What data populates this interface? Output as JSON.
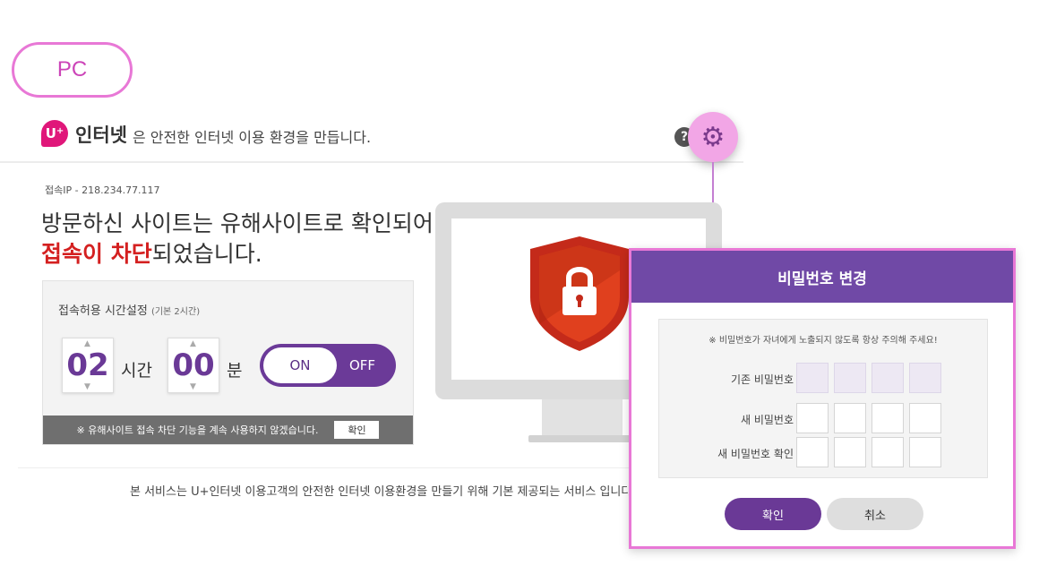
{
  "pc_tag": "PC",
  "header": {
    "logo_text": "U",
    "brand_name": "인터넷",
    "tagline": "은 안전한 인터넷 이용 환경을 만듭니다.",
    "help_icon": "?",
    "icons": [
      "question-icon",
      "gear-icon"
    ]
  },
  "access": {
    "ip_text": "접속IP - 218.234.77.117",
    "line1": "방문하신 사이트는 유해사이트로 확인되어",
    "line2_red": "접속이 차단",
    "line2_rest": "되었습니다."
  },
  "time_setting": {
    "title": "접속허용 시간설정",
    "title_note": "(기본 2시간)",
    "hours": "02",
    "hours_unit": "시간",
    "minutes": "00",
    "minutes_unit": "분",
    "toggle_on": "ON",
    "toggle_off": "OFF",
    "footer_text": "※ 유해사이트 접속 차단 기능을 계속 사용하지 않겠습니다.",
    "footer_button": "확인"
  },
  "service_note": "본 서비스는 U+인터넷 이용고객의 안전한 인터넷 이용환경을 만들기 위해 기본 제공되는 서비스 입니다.",
  "dialog": {
    "title": "비밀번호 변경",
    "notice": "※ 비밀번호가 자녀에게 노출되지 않도록 항상 주의해 주세요!",
    "current_pw_label": "기존 비밀번호",
    "new_pw_label": "새 비밀번호",
    "confirm_pw_label": "새 비밀번호 확인",
    "confirm_button": "확인",
    "cancel_button": "취소"
  },
  "colors": {
    "accent_purple": "#6a3996",
    "highlight_pink": "#e878d6",
    "block_red": "#d42020"
  }
}
